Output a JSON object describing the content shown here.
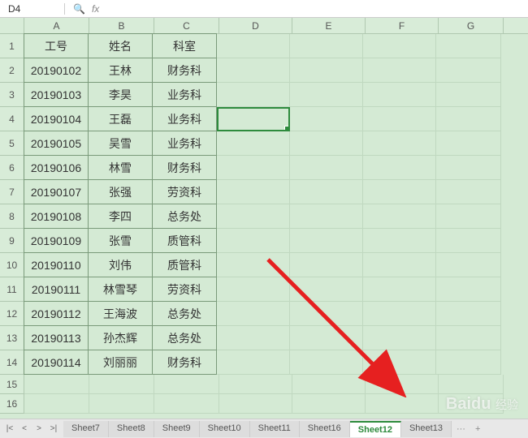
{
  "name_box": "D4",
  "fx_label": "fx",
  "columns": [
    "A",
    "B",
    "C",
    "D",
    "E",
    "F",
    "G"
  ],
  "row_count": 16,
  "selected_cell": "D4",
  "watermark": {
    "brand": "Baidu",
    "sub": "经验"
  },
  "chart_data": {
    "type": "table",
    "headers": [
      "工号",
      "姓名",
      "科室"
    ],
    "rows": [
      [
        "20190102",
        "王林",
        "财务科"
      ],
      [
        "20190103",
        "李昊",
        "业务科"
      ],
      [
        "20190104",
        "王磊",
        "业务科"
      ],
      [
        "20190105",
        "吴雪",
        "业务科"
      ],
      [
        "20190106",
        "林雪",
        "财务科"
      ],
      [
        "20190107",
        "张强",
        "劳资科"
      ],
      [
        "20190108",
        "李四",
        "总务处"
      ],
      [
        "20190109",
        "张雪",
        "质管科"
      ],
      [
        "20190110",
        "刘伟",
        "质管科"
      ],
      [
        "20190111",
        "林雪琴",
        "劳资科"
      ],
      [
        "20190112",
        "王海波",
        "总务处"
      ],
      [
        "20190113",
        "孙杰辉",
        "总务处"
      ],
      [
        "20190114",
        "刘丽丽",
        "财务科"
      ]
    ]
  },
  "sheet_nav": {
    "first": "K",
    "prev": "<",
    "next": ">",
    "last": ">|"
  },
  "sheet_tabs": [
    "Sheet7",
    "Sheet8",
    "Sheet9",
    "Sheet10",
    "Sheet11",
    "Sheet16",
    "Sheet12",
    "Sheet13"
  ],
  "active_tab": "Sheet12",
  "tab_more": "···",
  "tab_add": "+"
}
